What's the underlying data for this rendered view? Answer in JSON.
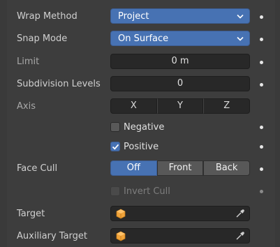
{
  "wrap_method": {
    "label": "Wrap Method",
    "value": "Project"
  },
  "snap_mode": {
    "label": "Snap Mode",
    "value": "On Surface"
  },
  "limit": {
    "label": "Limit",
    "value": "0 m"
  },
  "subdivision_levels": {
    "label": "Subdivision Levels",
    "value": "0"
  },
  "axis": {
    "label": "Axis",
    "options": [
      "X",
      "Y",
      "Z"
    ]
  },
  "negative": {
    "label": "Negative",
    "checked": false
  },
  "positive": {
    "label": "Positive",
    "checked": true
  },
  "face_cull": {
    "label": "Face Cull",
    "options": [
      "Off",
      "Front",
      "Back"
    ],
    "selected": "Off"
  },
  "invert_cull": {
    "label": "Invert Cull",
    "checked": false,
    "enabled": false
  },
  "target": {
    "label": "Target",
    "value": ""
  },
  "auxiliary_target": {
    "label": "Auxiliary Target",
    "value": ""
  },
  "icons": {
    "object": "object-cube-icon",
    "picker": "eyedropper-icon",
    "keyframe": "keyframe-dot-icon"
  },
  "colors": {
    "accent": "#4772b3",
    "object_icon": "#f0a33a"
  }
}
